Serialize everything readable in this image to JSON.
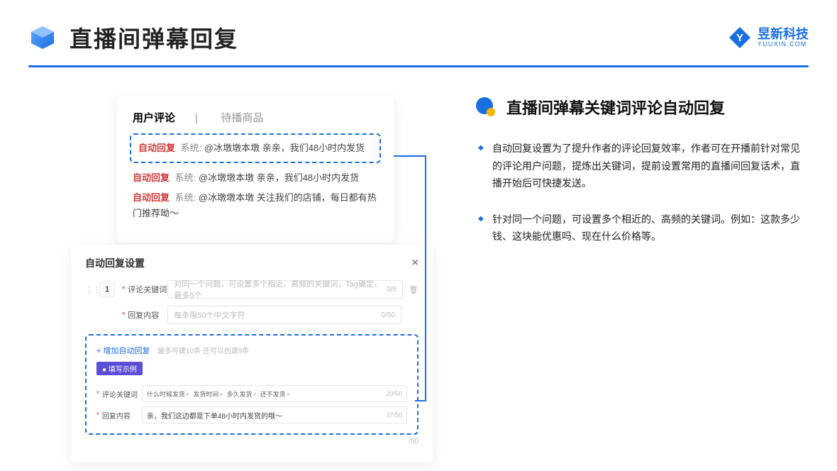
{
  "header": {
    "title": "直播间弹幕回复",
    "brandName": "昱新科技",
    "brandSub": "YUUXIN.COM"
  },
  "cardTop": {
    "tab1": "用户评论",
    "tab2": "待播商品",
    "msgTag": "自动回复",
    "msgSys": "系统:",
    "msg1": "@冰墩墩本墩 亲亲，我们48小时内发货",
    "msg2": "@冰墩墩本墩 亲亲，我们48小时内发货",
    "msg3": "@冰墩墩本墩 关注我们的店铺，每日都有热门推荐呦～"
  },
  "cardBot": {
    "title": "自动回复设置",
    "rowNum": "1",
    "lab1": "评论关键词",
    "ph1": "对同一个问题，可设置多个相近、高频的关键词，Tag确定，最多5个",
    "cnt1": "0/5",
    "lab2": "回复内容",
    "ph2": "每条限50个中文字符",
    "cnt2": "0/50",
    "addLink": "+ 增加自动回复",
    "addHint": "最多可建10条 还可以创建9条",
    "badge": "● 填写示例",
    "exLab1": "评论关键词",
    "exChips": [
      "什么时候发货",
      "发货时间",
      "多久发货",
      "还不发货"
    ],
    "exCnt1": "20/50",
    "exLab2": "回复内容",
    "exVal": "亲，我们这边都是下单48小时内发货的哦～",
    "exCnt2": "37/50",
    "bottomCnt": "/50"
  },
  "info": {
    "heading": "直播间弹幕关键词评论自动回复",
    "b1": "自动回复设置为了提升作者的评论回复效率，作者可在开播前针对常见的评论用户问题，提炼出关键词，提前设置常用的直播间回复话术，直播开始后可快捷发送。",
    "b2": "针对同一个问题，可设置多个相近的、高频的关键词。例如：这款多少钱、这块能优惠吗、现在什么价格等。"
  }
}
